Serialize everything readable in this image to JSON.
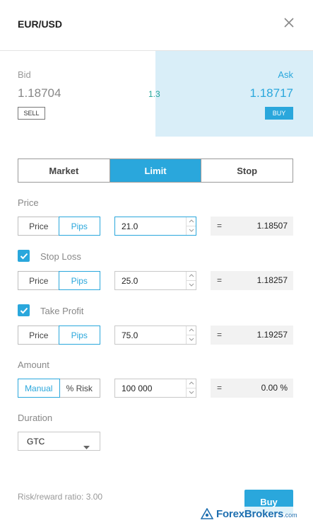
{
  "header": {
    "title": "EUR/USD"
  },
  "quote": {
    "bid_label": "Bid",
    "bid_price": "1.18704",
    "sell_label": "SELL",
    "spread": "1.3",
    "ask_label": "Ask",
    "ask_price": "1.18717",
    "buy_label": "BUY"
  },
  "tabs": [
    {
      "label": "Market",
      "active": false
    },
    {
      "label": "Limit",
      "active": true
    },
    {
      "label": "Stop",
      "active": false
    }
  ],
  "price": {
    "label": "Price",
    "modes": [
      "Price",
      "Pips"
    ],
    "active_mode": "Pips",
    "value": "21.0",
    "equals": "=",
    "result": "1.18507"
  },
  "stop_loss": {
    "label": "Stop Loss",
    "checked": true,
    "modes": [
      "Price",
      "Pips"
    ],
    "active_mode": "Pips",
    "value": "25.0",
    "equals": "=",
    "result": "1.18257"
  },
  "take_profit": {
    "label": "Take Profit",
    "checked": true,
    "modes": [
      "Price",
      "Pips"
    ],
    "active_mode": "Pips",
    "value": "75.0",
    "equals": "=",
    "result": "1.19257"
  },
  "amount": {
    "label": "Amount",
    "modes": [
      "Manual",
      "% Risk"
    ],
    "active_mode": "Manual",
    "value": "100 000",
    "equals": "=",
    "result": "0.00 %"
  },
  "duration": {
    "label": "Duration",
    "selected": "GTC"
  },
  "footer": {
    "risk_reward": "Risk/reward ratio: 3.00",
    "buy_label": "Buy"
  },
  "watermark": {
    "brand": "ForexBrokers",
    "suffix": ".com"
  },
  "colors": {
    "accent": "#2aa7dc",
    "ask_bg": "#d9eef8",
    "spread": "#26a69a"
  }
}
